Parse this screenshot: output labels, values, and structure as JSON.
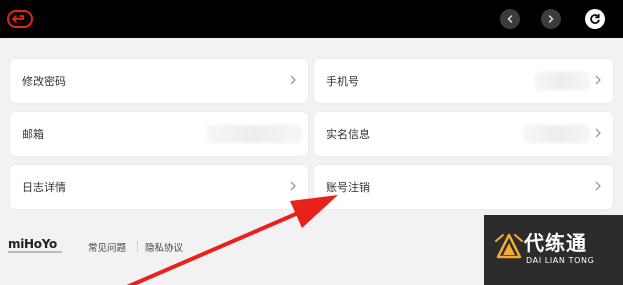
{
  "topbar": {
    "back_icon": "back-return-icon",
    "prev_icon": "chevron-left-icon",
    "next_icon": "chevron-right-icon",
    "refresh_icon": "refresh-icon"
  },
  "settings": {
    "left": [
      {
        "label": "修改密码",
        "value": "",
        "has_chevron": true
      },
      {
        "label": "邮箱",
        "value": "",
        "has_chevron": false
      },
      {
        "label": "日志详情",
        "value": "",
        "has_chevron": true
      }
    ],
    "right": [
      {
        "label": "手机号",
        "value": "",
        "has_chevron": true
      },
      {
        "label": "实名信息",
        "value": "",
        "has_chevron": true
      },
      {
        "label": "账号注销",
        "value": "",
        "has_chevron": true
      }
    ]
  },
  "footer": {
    "logo": "miHoYo",
    "links": [
      "常见问题",
      "隐私协议"
    ]
  },
  "watermark": {
    "title": "代练通",
    "subtitle": "DAI LIAN TONG"
  },
  "colors": {
    "arrow": "#e8221b",
    "back_icon": "#e8221b",
    "topbar": "#000000",
    "card_bg": "#ffffff",
    "page_bg": "#f2f2f4"
  }
}
